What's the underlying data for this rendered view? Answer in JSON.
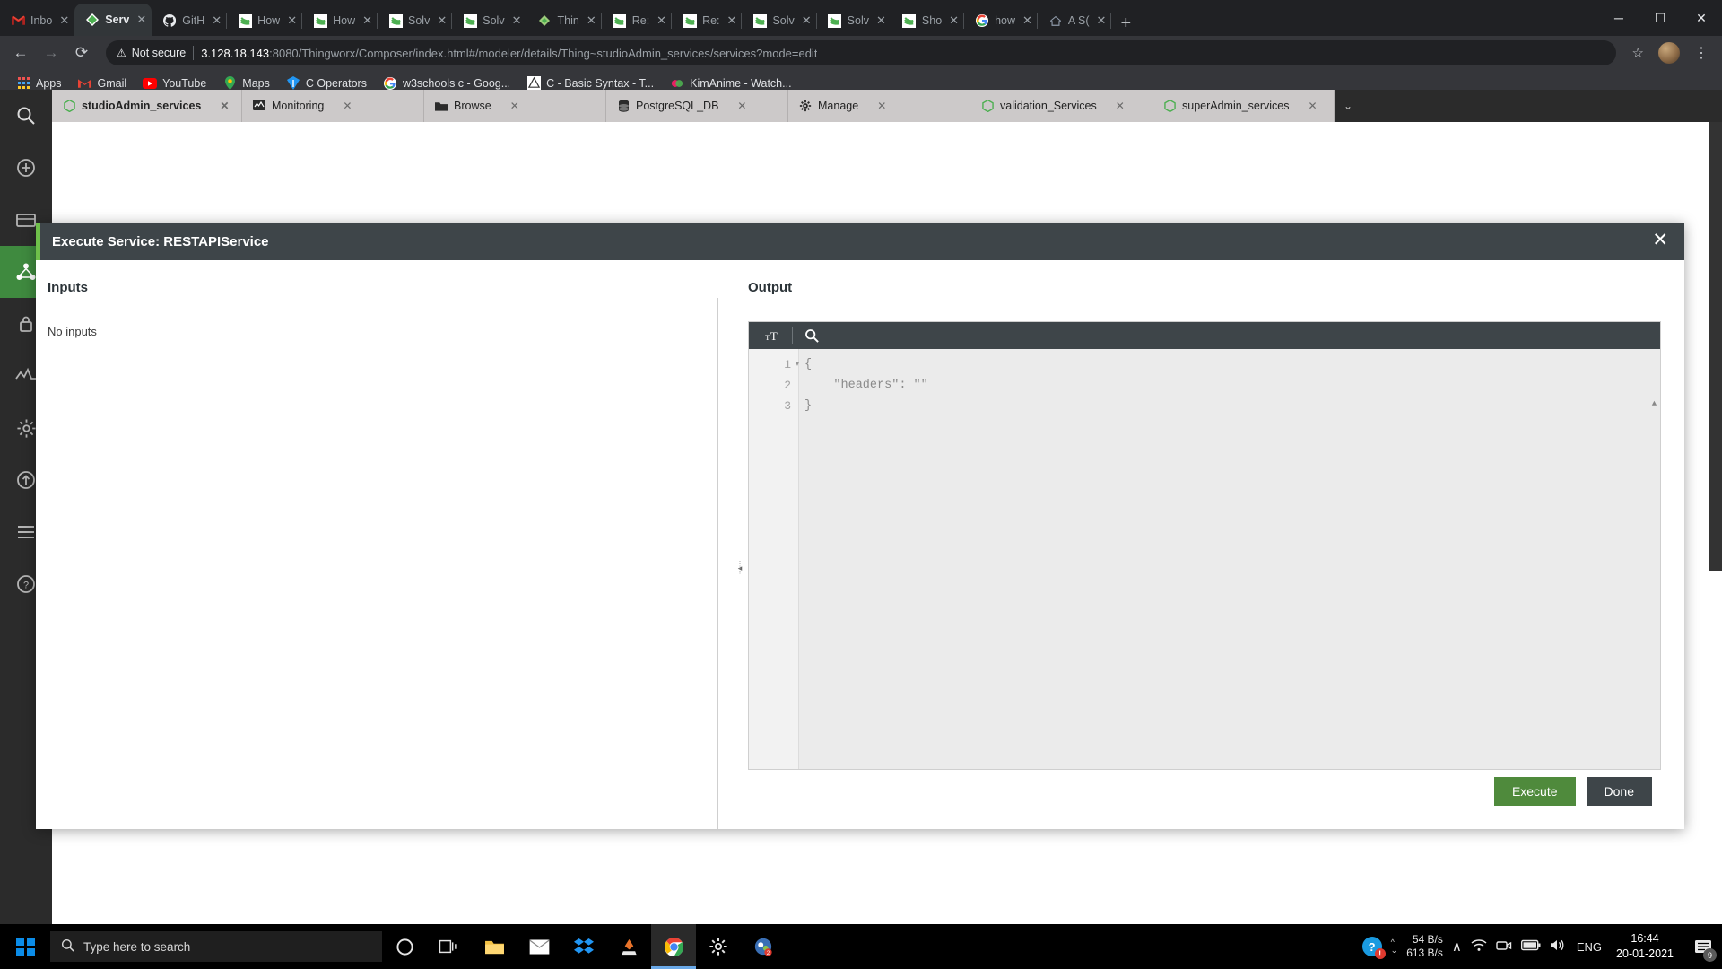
{
  "browser": {
    "tabs": [
      {
        "title": "Inbo",
        "icon": "gmail-icon",
        "active": false
      },
      {
        "title": "Serv",
        "icon": "thingworx-icon",
        "active": true
      },
      {
        "title": "GitH",
        "icon": "github-icon",
        "active": false
      },
      {
        "title": "How",
        "icon": "stackoverflow-icon",
        "active": false
      },
      {
        "title": "How",
        "icon": "stackoverflow-icon",
        "active": false
      },
      {
        "title": "Solv",
        "icon": "stackoverflow-icon",
        "active": false
      },
      {
        "title": "Solv",
        "icon": "stackoverflow-icon",
        "active": false
      },
      {
        "title": "Thin",
        "icon": "thingworx-icon",
        "active": false
      },
      {
        "title": "Re: ",
        "icon": "stackoverflow-icon",
        "active": false
      },
      {
        "title": "Re: ",
        "icon": "stackoverflow-icon",
        "active": false
      },
      {
        "title": "Solv",
        "icon": "stackoverflow-icon",
        "active": false
      },
      {
        "title": "Solv",
        "icon": "stackoverflow-icon",
        "active": false
      },
      {
        "title": "Sho",
        "icon": "stackoverflow-icon",
        "active": false
      },
      {
        "title": "how",
        "icon": "google-icon",
        "active": false
      },
      {
        "title": "A S(",
        "icon": "home-icon",
        "active": false
      }
    ],
    "new_tab_label": "+",
    "window_controls": {
      "minimize": "─",
      "maximize": "☐",
      "close": "✕"
    },
    "nav": {
      "back": "←",
      "forward": "→",
      "reload": "⟳"
    },
    "omnibox": {
      "security_label": "Not secure",
      "warning_glyph": "⚠",
      "url_host": "3.128.18.143",
      "url_rest": ":8080/Thingworx/Composer/index.html#/modeler/details/Thing~studioAdmin_services/services?mode=edit",
      "star_glyph": "☆",
      "menu_glyph": "⋮"
    },
    "bookmarks": [
      {
        "label": "Apps",
        "icon": "apps-grid-icon"
      },
      {
        "label": "Gmail",
        "icon": "gmail-icon"
      },
      {
        "label": "YouTube",
        "icon": "youtube-icon"
      },
      {
        "label": "Maps",
        "icon": "maps-pin-icon"
      },
      {
        "label": "C Operators",
        "icon": "blue-diamond-icon"
      },
      {
        "label": "w3schools c - Goog...",
        "icon": "google-icon"
      },
      {
        "label": "C - Basic Syntax - T...",
        "icon": "tutorialspoint-icon"
      },
      {
        "label": "KimAnime - Watch...",
        "icon": "kimanime-icon"
      }
    ]
  },
  "thingworx": {
    "rail_icons": [
      {
        "name": "search-icon",
        "glyph": "⚲",
        "selected": false
      },
      {
        "name": "add-icon",
        "glyph": "⊕",
        "selected": false
      },
      {
        "name": "storage-icon",
        "glyph": "▤",
        "selected": false
      },
      {
        "name": "modeling-icon",
        "glyph": "⚭",
        "selected": true
      },
      {
        "name": "security-icon",
        "glyph": "⚿",
        "selected": false
      },
      {
        "name": "monitoring-icon",
        "glyph": "⤳",
        "selected": false
      },
      {
        "name": "settings-icon",
        "glyph": "⚙",
        "selected": false
      },
      {
        "name": "import-export-icon",
        "glyph": "↑",
        "selected": false
      },
      {
        "name": "extensions-icon",
        "glyph": "☰",
        "selected": false
      },
      {
        "name": "help-icon",
        "glyph": "?",
        "selected": false
      }
    ],
    "tabs": [
      {
        "label": "studioAdmin_services",
        "icon": "hexagon-icon",
        "active": true
      },
      {
        "label": "Monitoring",
        "icon": "monitoring-icon",
        "active": false
      },
      {
        "label": "Browse",
        "icon": "folder-icon",
        "active": false
      },
      {
        "label": "PostgreSQL_DB",
        "icon": "database-icon",
        "active": false
      },
      {
        "label": "Manage",
        "icon": "gear-icon",
        "active": false
      },
      {
        "label": "validation_Services",
        "icon": "hexagon-icon",
        "active": false
      },
      {
        "label": "superAdmin_services",
        "icon": "hexagon-icon",
        "active": false
      }
    ],
    "tabs_more_glyph": "⌄",
    "tab_close_glyph": "✕"
  },
  "modal": {
    "title": "Execute Service: RESTAPIService",
    "close_glyph": "✕",
    "inputs": {
      "heading": "Inputs",
      "empty_text": "No inputs"
    },
    "output": {
      "heading": "Output",
      "toolbar": [
        {
          "name": "font-size-icon",
          "label": "ᴛT"
        },
        {
          "name": "search-icon",
          "label": "⌕"
        }
      ],
      "lines": [
        {
          "number": "1",
          "foldable": true,
          "text": "{"
        },
        {
          "number": "2",
          "foldable": false,
          "text": "    \"headers\": \"\""
        },
        {
          "number": "3",
          "foldable": false,
          "text": "}"
        }
      ]
    },
    "footer": {
      "execute_label": "Execute",
      "done_label": "Done"
    }
  },
  "taskbar": {
    "search_placeholder": "Type here to search",
    "search_icon": "search-icon",
    "icons": [
      {
        "name": "cortana-icon",
        "glyph": "○"
      },
      {
        "name": "task-view-icon",
        "glyph": "⧉"
      },
      {
        "name": "file-explorer-icon",
        "glyph": "▧"
      },
      {
        "name": "mail-icon",
        "glyph": "✉"
      },
      {
        "name": "dropbox-icon",
        "glyph": "❖"
      },
      {
        "name": "vlc-icon",
        "glyph": "⤴"
      },
      {
        "name": "chrome-icon",
        "glyph": "◉"
      },
      {
        "name": "settings-icon",
        "glyph": "⚙"
      },
      {
        "name": "notification-app-icon",
        "glyph": "◐"
      }
    ],
    "tray": {
      "help_glyph": "?",
      "net_up": "54 B/s",
      "net_down": "613 B/s",
      "chevron_glyph": "∧",
      "wifi_glyph": "◠",
      "camera_glyph": "▣",
      "battery_glyph": "▭",
      "volume_glyph": "ᵔ",
      "language": "ENG",
      "time": "16:44",
      "date": "20-01-2021",
      "notification_count": "9"
    }
  },
  "colors": {
    "accent_green": "#6fbf4a",
    "execute_green": "#4f8a3c",
    "header_dark": "#3e4549",
    "chrome_dark": "#202124"
  }
}
